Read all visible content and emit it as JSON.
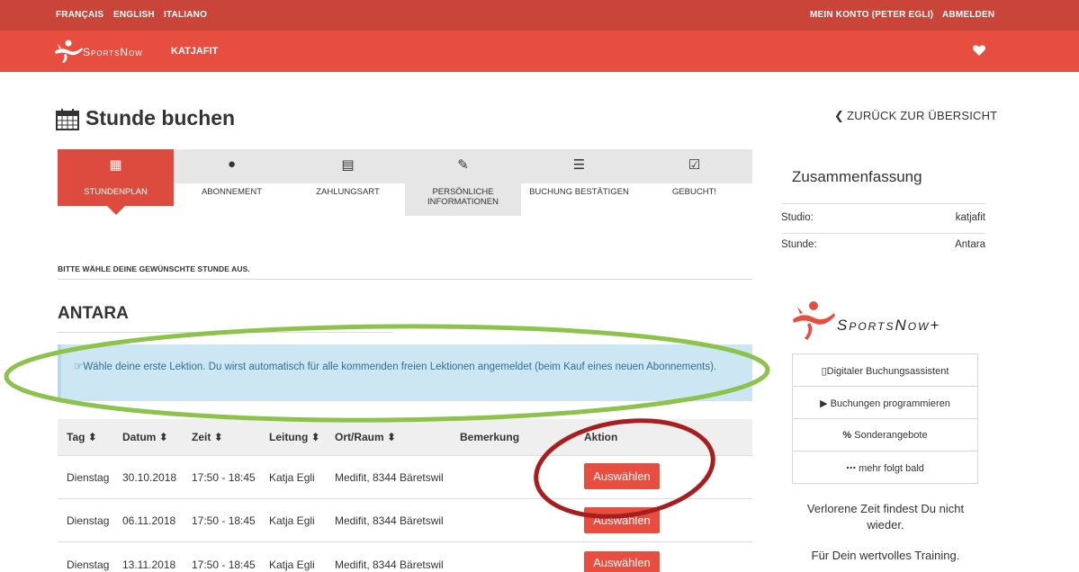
{
  "topbar": {
    "languages": [
      "FRANÇAIS",
      "ENGLISH",
      "ITALIANO"
    ],
    "account": "MEIN KONTO (PETER EGLI)",
    "logout": "ABMELDEN"
  },
  "brandbar": {
    "brand": "SportsNow",
    "studio": "KATJAFIT"
  },
  "page": {
    "title": "Stunde buchen",
    "back": "ZURÜCK ZUR ÜBERSICHT",
    "instruction": "BITTE WÄHLE DEINE GEWÜNSCHTE STUNDE AUS.",
    "class_name": "ANTARA",
    "info": "Wähle deine erste Lektion. Du wirst automatisch für alle kommenden freien Lektionen angemeldet (beim Kauf eines neuen Abonnements)."
  },
  "steps": [
    {
      "label": "STUNDENPLAN",
      "icon": "calendar-icon"
    },
    {
      "label": "ABONNEMENT",
      "icon": "map-marker-icon"
    },
    {
      "label": "ZAHLUNGSART",
      "icon": "money-icon"
    },
    {
      "label": "PERSÖNLICHE INFORMATIONEN",
      "icon": "edit-icon"
    },
    {
      "label": "BUCHUNG BESTÄTIGEN",
      "icon": "list-icon"
    },
    {
      "label": "GEBUCHT!",
      "icon": "check-square-icon"
    }
  ],
  "table": {
    "headers": {
      "tag": "Tag",
      "datum": "Datum",
      "zeit": "Zeit",
      "leitung": "Leitung",
      "ort": "Ort/Raum",
      "bemerkung": "Bemerkung",
      "aktion": "Aktion"
    },
    "sort_glyph": "⬍",
    "rows": [
      {
        "tag": "Dienstag",
        "datum": "30.10.2018",
        "zeit": "17:50 - 18:45",
        "leitung": "Katja Egli",
        "ort": "Medifit, 8344 Bäretswil",
        "action": "Auswählen"
      },
      {
        "tag": "Dienstag",
        "datum": "06.11.2018",
        "zeit": "17:50 - 18:45",
        "leitung": "Katja Egli",
        "ort": "Medifit, 8344 Bäretswil",
        "action": "Auswählen"
      },
      {
        "tag": "Dienstag",
        "datum": "13.11.2018",
        "zeit": "17:50 - 18:45",
        "leitung": "Katja Egli",
        "ort": "Medifit, 8344 Bäretswil",
        "action": "Auswählen"
      }
    ]
  },
  "summary": {
    "title": "Zusammenfassung",
    "items": [
      {
        "label": "Studio:",
        "value": "katjafit"
      },
      {
        "label": "Stunde:",
        "value": "Antara"
      }
    ]
  },
  "plus": {
    "brand": "SportsNow+",
    "features": [
      "Digitaler Buchungsassistent",
      "Buchungen programmieren",
      "Sonderangebote",
      "mehr folgt bald"
    ],
    "feature_icons": [
      "mobile-icon",
      "play-icon",
      "percent-icon",
      "ellipsis-icon"
    ],
    "tagline1": "Verlorene Zeit findest Du nicht wieder.",
    "tagline2": "Für Dein wertvolles Training."
  },
  "colors": {
    "topbar": "#c9453a",
    "brandbar": "#e84e40",
    "accent": "#e84e40",
    "info_bg": "#cce7f3",
    "annotation_green": "#8dc34a",
    "annotation_red": "#a81d1d"
  }
}
